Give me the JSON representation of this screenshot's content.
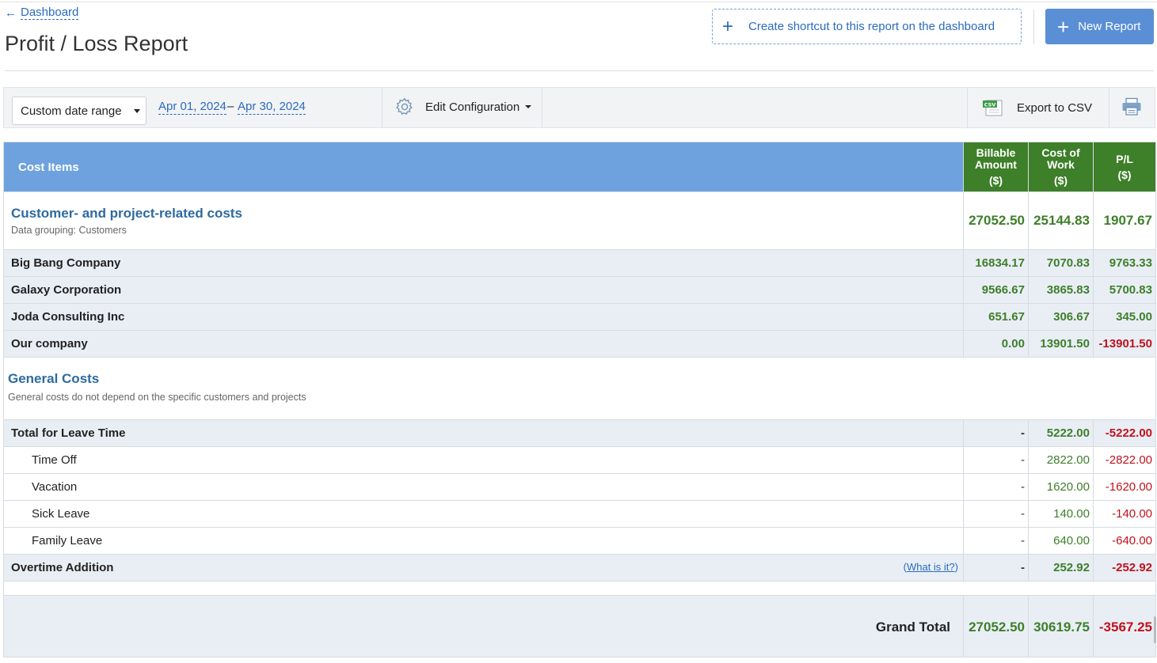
{
  "header": {
    "back_label": "Dashboard",
    "title": "Profit / Loss Report",
    "shortcut_label": "Create shortcut to this report on the dashboard",
    "new_report_label": "New Report"
  },
  "toolbar": {
    "date_range_select": "Custom date range",
    "date_from": "Apr 01, 2024",
    "date_separator": "–",
    "date_to": "Apr 30, 2024",
    "edit_config_label": "Edit Configuration",
    "export_label": "Export to CSV",
    "csv_icon_text": "CSV"
  },
  "table": {
    "headers": {
      "cost_items": "Cost Items",
      "billable_line1": "Billable",
      "billable_line2": "Amount",
      "cost_line1": "Cost of",
      "cost_line2": "Work",
      "pl_line1": "P/L",
      "unit": "($)"
    },
    "customer_group": {
      "title": "Customer- and project-related costs",
      "subtitle": "Data grouping: Customers",
      "billable": "27052.50",
      "cost": "25144.83",
      "pl": "1907.67"
    },
    "customers": [
      {
        "name": "Big Bang Company",
        "billable": "16834.17",
        "cost": "7070.83",
        "pl": "9763.33"
      },
      {
        "name": "Galaxy Corporation",
        "billable": "9566.67",
        "cost": "3865.83",
        "pl": "5700.83"
      },
      {
        "name": "Joda Consulting Inc",
        "billable": "651.67",
        "cost": "306.67",
        "pl": "345.00"
      },
      {
        "name": "Our company",
        "billable": "0.00",
        "cost": "13901.50",
        "pl": "-13901.50"
      }
    ],
    "general_group": {
      "title": "General Costs",
      "subtitle": "General costs do not depend on the specific customers and projects"
    },
    "leave_total": {
      "name": "Total for Leave Time",
      "billable": "-",
      "cost": "5222.00",
      "pl": "-5222.00"
    },
    "leave_items": [
      {
        "name": "Time Off",
        "billable": "-",
        "cost": "2822.00",
        "pl": "-2822.00"
      },
      {
        "name": "Vacation",
        "billable": "-",
        "cost": "1620.00",
        "pl": "-1620.00"
      },
      {
        "name": "Sick Leave",
        "billable": "-",
        "cost": "140.00",
        "pl": "-140.00"
      },
      {
        "name": "Family Leave",
        "billable": "-",
        "cost": "640.00",
        "pl": "-640.00"
      }
    ],
    "overtime": {
      "name": "Overtime Addition",
      "help_open": "(",
      "help_link": "What is it?",
      "help_close": ")",
      "billable": "-",
      "cost": "252.92",
      "pl": "-252.92"
    },
    "grand_total": {
      "label": "Grand Total",
      "billable": "27052.50",
      "cost": "30619.75",
      "pl": "-3567.25"
    }
  },
  "colors": {
    "header_blue": "#6ea2de",
    "header_green": "#3e7f2a",
    "positive": "#3e7f2a",
    "negative": "#c0121c",
    "link": "#2a6bbf",
    "button_blue": "#5a8fd5"
  },
  "icons": [
    "arrow-left-icon",
    "plus-icon",
    "gear-icon",
    "csv-file-icon",
    "printer-icon",
    "caret-down-icon"
  ]
}
